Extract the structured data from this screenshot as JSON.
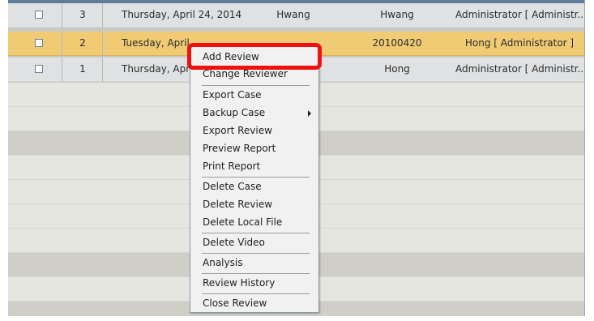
{
  "rows": [
    {
      "num": "3",
      "date": "Thursday, April 24, 2014",
      "col_a": "Hwang",
      "col_b": "Hwang",
      "col_c": "Administrator [ Administr..."
    },
    {
      "num": "2",
      "date": "Tuesday, April",
      "col_a": "",
      "col_b": "20100420",
      "col_c": "Hong [ Administrator ]"
    },
    {
      "num": "1",
      "date": "Thursday, April",
      "col_a": "",
      "col_b": "Hong",
      "col_c": "Administrator [ Administr..."
    }
  ],
  "context_menu": {
    "items": [
      {
        "label": "Add Review"
      },
      {
        "label": "Change Reviewer"
      },
      {
        "label": "Export Case"
      },
      {
        "label": "Backup Case",
        "submenu": true
      },
      {
        "label": "Export Review"
      },
      {
        "label": "Preview Report"
      },
      {
        "label": "Print Report"
      },
      {
        "label": "Delete Case"
      },
      {
        "label": "Delete Review"
      },
      {
        "label": "Delete Local File"
      },
      {
        "label": "Delete Video"
      },
      {
        "label": "Analysis"
      },
      {
        "label": "Review History"
      },
      {
        "label": "Close Review"
      }
    ],
    "highlighted": "Add Review"
  },
  "colors": {
    "selected_row": "#f0cb74",
    "header_line": "#5f7d9b",
    "highlight_box": "#ee1111"
  }
}
